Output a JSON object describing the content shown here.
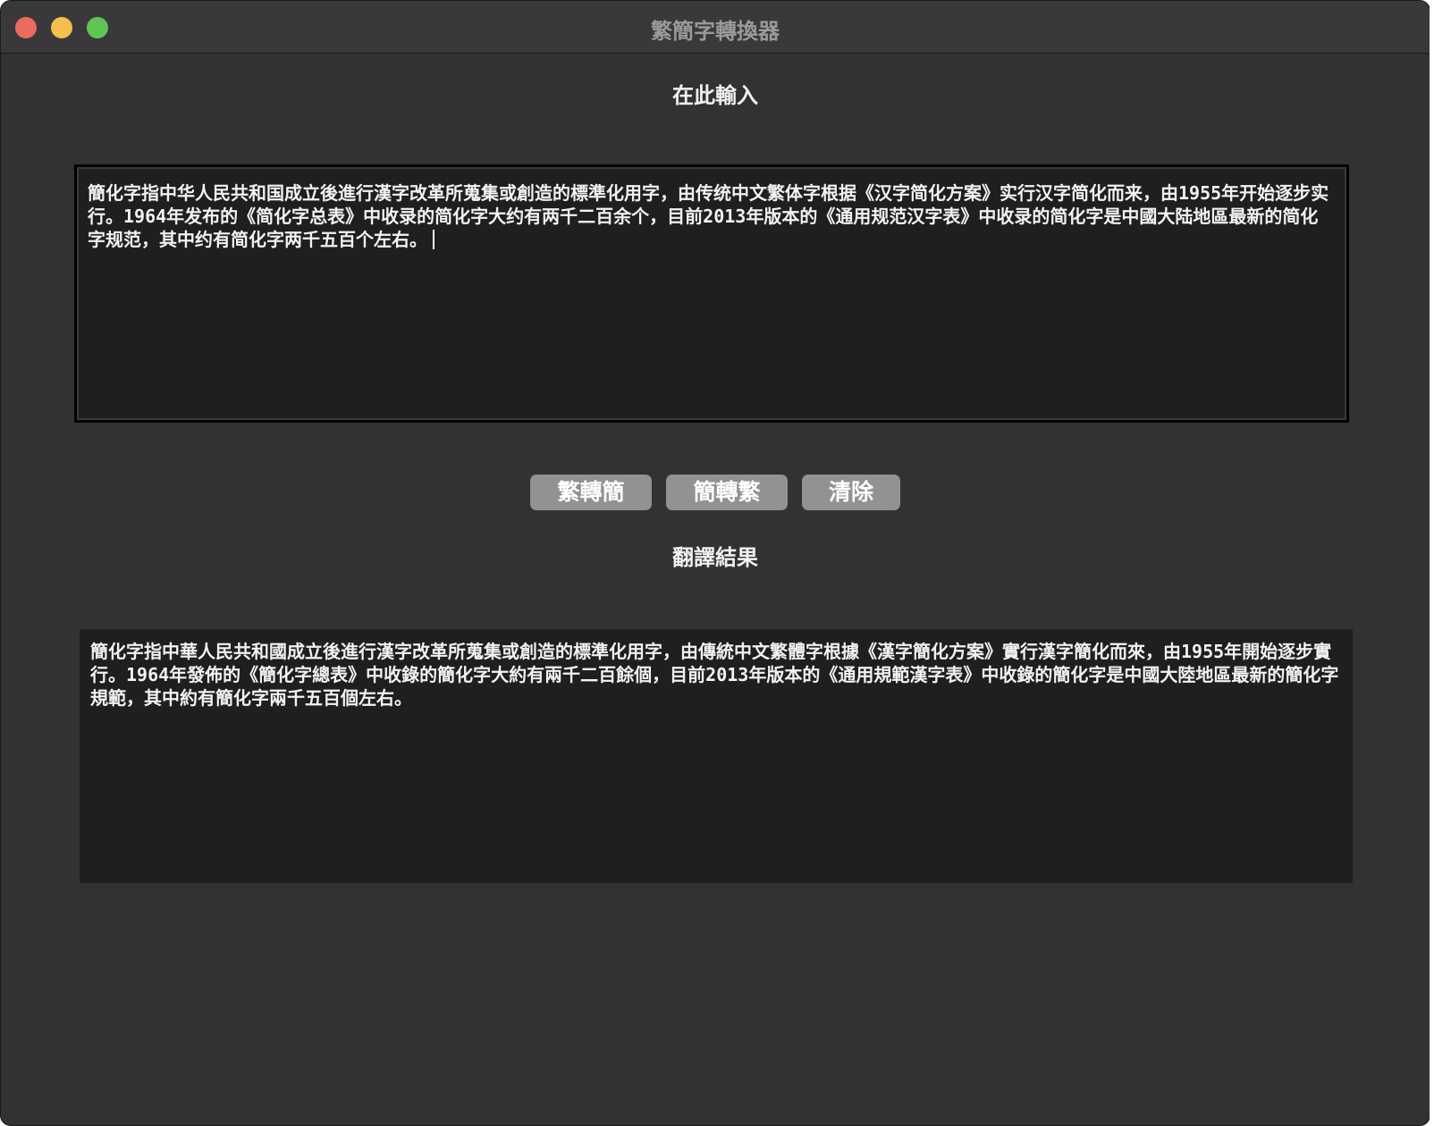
{
  "window": {
    "title": "繁簡字轉換器"
  },
  "input": {
    "label": "在此輸入",
    "text": "簡化字指中华人民共和国成立後進行漢字改革所蒐集或創造的標準化用字，由传统中文繁体字根据《汉字简化方案》实行汉字简化而来，由1955年开始逐步实行。1964年发布的《简化字总表》中收录的简化字大约有两千二百余个，目前2013年版本的《通用规范汉字表》中收录的简化字是中國大陆地區最新的简化字规范，其中约有简化字两千五百个左右。"
  },
  "buttons": {
    "trad_to_simp": "繁轉簡",
    "simp_to_trad": "簡轉繁",
    "clear": "清除"
  },
  "output": {
    "label": "翻譯結果",
    "text": "簡化字指中華人民共和國成立後進行漢字改革所蒐集或創造的標準化用字，由傳統中文繁體字根據《漢字簡化方案》實行漢字簡化而來，由1955年開始逐步實行。1964年發佈的《簡化字總表》中收錄的簡化字大約有兩千二百餘個，目前2013年版本的《通用規範漢字表》中收錄的簡化字是中國大陸地區最新的簡化字規範，其中約有簡化字兩千五百個左右。"
  },
  "colors": {
    "window_bg": "#323232",
    "titlebar_bg": "#3a383b",
    "textbox_bg": "#1f1f1f",
    "button_bg": "#929292",
    "close": "#ec6a5e",
    "minimize": "#f4bf4f",
    "maximize": "#61c554"
  }
}
